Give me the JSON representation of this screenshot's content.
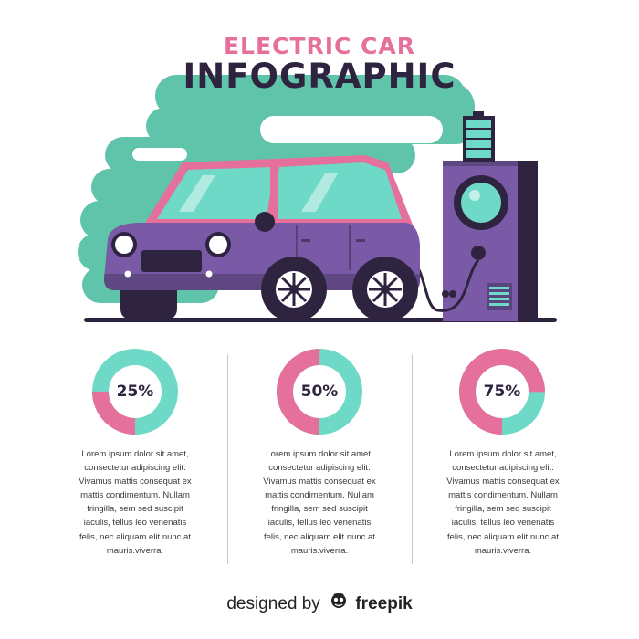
{
  "header": {
    "title_line1": "ELECTRIC CAR",
    "title_line2": "INFOGRAPHIC"
  },
  "colors": {
    "pink": "#e6709c",
    "teal": "#6fd9c7",
    "purple": "#7a5aa6",
    "dark": "#2f2440",
    "mint": "#5fc4a9"
  },
  "stats": [
    {
      "percent_label": "25%",
      "percent": 25,
      "body": "Lorem ipsum dolor sit amet, consectetur adipiscing elit. Vivamus mattis consequat ex mattis condimentum. Nullam fringilla, sem sed suscipit iaculis, tellus leo venenatis felis, nec aliquam elit nunc at mauris.viverra."
    },
    {
      "percent_label": "50%",
      "percent": 50,
      "body": "Lorem ipsum dolor sit amet, consectetur adipiscing elit. Vivamus mattis consequat ex mattis condimentum. Nullam fringilla, sem sed suscipit iaculis, tellus leo venenatis felis, nec aliquam elit nunc at mauris.viverra."
    },
    {
      "percent_label": "75%",
      "percent": 75,
      "body": "Lorem ipsum dolor sit amet, consectetur adipiscing elit. Vivamus mattis consequat ex mattis condimentum. Nullam fringilla, sem sed suscipit iaculis, tellus leo venenatis felis, nec aliquam elit nunc at mauris.viverra."
    }
  ],
  "footer": {
    "designed_by": "designed by",
    "brand": "freepik",
    "logo_icon": "freepik-logo-icon"
  }
}
